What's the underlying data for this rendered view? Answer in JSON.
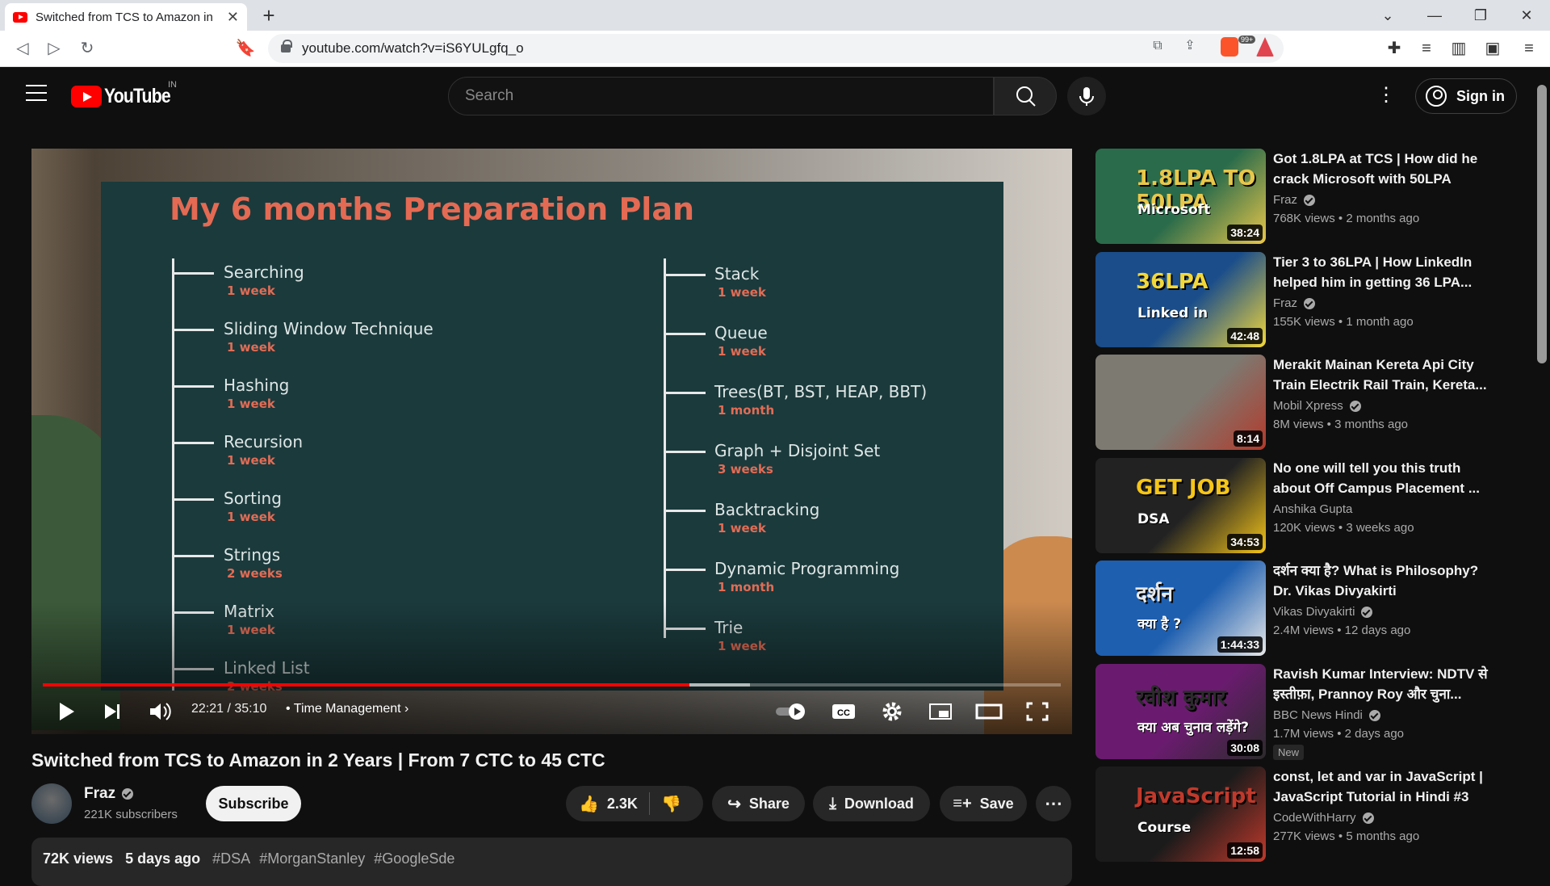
{
  "browser": {
    "tab_title": "Switched from TCS to Amazon in",
    "url": "youtube.com/watch?v=iS6YULgfq_o",
    "brave_badge": "99+"
  },
  "header": {
    "logo_text": "YouTube",
    "country": "IN",
    "search_placeholder": "Search",
    "signin_label": "Sign in"
  },
  "player": {
    "slide": {
      "title": "My 6 months Preparation Plan",
      "left": [
        {
          "topic": "Searching",
          "duration": "1 week"
        },
        {
          "topic": "Sliding Window Technique",
          "duration": "1 week"
        },
        {
          "topic": "Hashing",
          "duration": "1 week"
        },
        {
          "topic": "Recursion",
          "duration": "1 week"
        },
        {
          "topic": "Sorting",
          "duration": "1 week"
        },
        {
          "topic": "Strings",
          "duration": "2 weeks"
        },
        {
          "topic": "Matrix",
          "duration": "1 week"
        },
        {
          "topic": "Linked List",
          "duration": "2 weeks"
        }
      ],
      "right": [
        {
          "topic": "Stack",
          "duration": "1 week"
        },
        {
          "topic": "Queue",
          "duration": "1 week"
        },
        {
          "topic": "Trees(BT, BST, HEAP, BBT)",
          "duration": "1 month"
        },
        {
          "topic": "Graph + Disjoint Set",
          "duration": "3 weeks"
        },
        {
          "topic": "Backtracking",
          "duration": "1 week"
        },
        {
          "topic": "Dynamic Programming",
          "duration": "1 month"
        },
        {
          "topic": "Trie",
          "duration": "1 week"
        }
      ]
    },
    "time": "22:21 / 35:10",
    "chapter": "Time Management",
    "progress": 0.635,
    "buffered": 0.695
  },
  "video": {
    "title": "Switched from TCS to Amazon in 2 Years | From 7 CTC to 45 CTC",
    "channel": "Fraz",
    "subscribers": "221K subscribers",
    "subscribe_label": "Subscribe",
    "likes": "2.3K",
    "share_label": "Share",
    "download_label": "Download",
    "save_label": "Save",
    "views": "72K views",
    "age": "5 days ago",
    "tags": [
      "#DSA",
      "#MorganStanley",
      "#GoogleSde"
    ]
  },
  "recommendations": [
    {
      "title": "Got 1.8LPA at TCS | How did he crack Microsoft with 50LPA",
      "channel": "Fraz",
      "verified": true,
      "views": "768K views",
      "age": "2 months ago",
      "duration": "38:24",
      "thumb_text": "1.8LPA TO 50LPA",
      "thumb_sub": "Microsoft",
      "colors": [
        "#2a6b4b",
        "#e9c74a"
      ]
    },
    {
      "title": "Tier 3 to 36LPA | How LinkedIn helped him in getting 36 LPA...",
      "channel": "Fraz",
      "verified": true,
      "views": "155K views",
      "age": "1 month ago",
      "duration": "42:48",
      "thumb_text": "36LPA",
      "thumb_sub": "Linked in",
      "colors": [
        "#1a4d8a",
        "#f2d73a"
      ]
    },
    {
      "title": "Merakit Mainan Kereta Api City Train Electrik Rail Train, Kereta...",
      "channel": "Mobil Xpress",
      "verified": true,
      "views": "8M views",
      "age": "3 months ago",
      "duration": "8:14",
      "thumb_text": "",
      "thumb_sub": "",
      "colors": [
        "#7d7a72",
        "#b33a2b"
      ]
    },
    {
      "title": "No one will tell you this truth about Off Campus Placement ...",
      "channel": "Anshika Gupta",
      "verified": false,
      "views": "120K views",
      "age": "3 weeks ago",
      "duration": "34:53",
      "thumb_text": "GET JOB",
      "thumb_sub": "DSA",
      "colors": [
        "#222222",
        "#f5c518"
      ]
    },
    {
      "title": "दर्शन क्या है? What is Philosophy? Dr. Vikas Divyakirti",
      "channel": "Vikas Divyakirti",
      "verified": true,
      "views": "2.4M views",
      "age": "12 days ago",
      "duration": "1:44:33",
      "thumb_text": "दर्शन",
      "thumb_sub": "क्या है ?",
      "colors": [
        "#1e5fb0",
        "#e8e8e8"
      ]
    },
    {
      "title": "Ravish Kumar Interview: NDTV से इस्तीफ़ा, Prannoy Roy और चुना...",
      "channel": "BBC News Hindi",
      "verified": true,
      "views": "1.7M views",
      "age": "2 days ago",
      "badge": "New",
      "duration": "30:08",
      "thumb_text": "रवीश कुमार",
      "thumb_sub": "क्या अब चुनाव लड़ेंगे?",
      "colors": [
        "#6a1b6f",
        "#2b2b2b"
      ]
    },
    {
      "title": "const, let and var in JavaScript | JavaScript Tutorial in Hindi #3",
      "channel": "CodeWithHarry",
      "verified": true,
      "views": "277K views",
      "age": "5 months ago",
      "duration": "12:58",
      "thumb_text": "JavaScript",
      "thumb_sub": "Course",
      "colors": [
        "#1b1b1b",
        "#c0392b"
      ]
    }
  ]
}
